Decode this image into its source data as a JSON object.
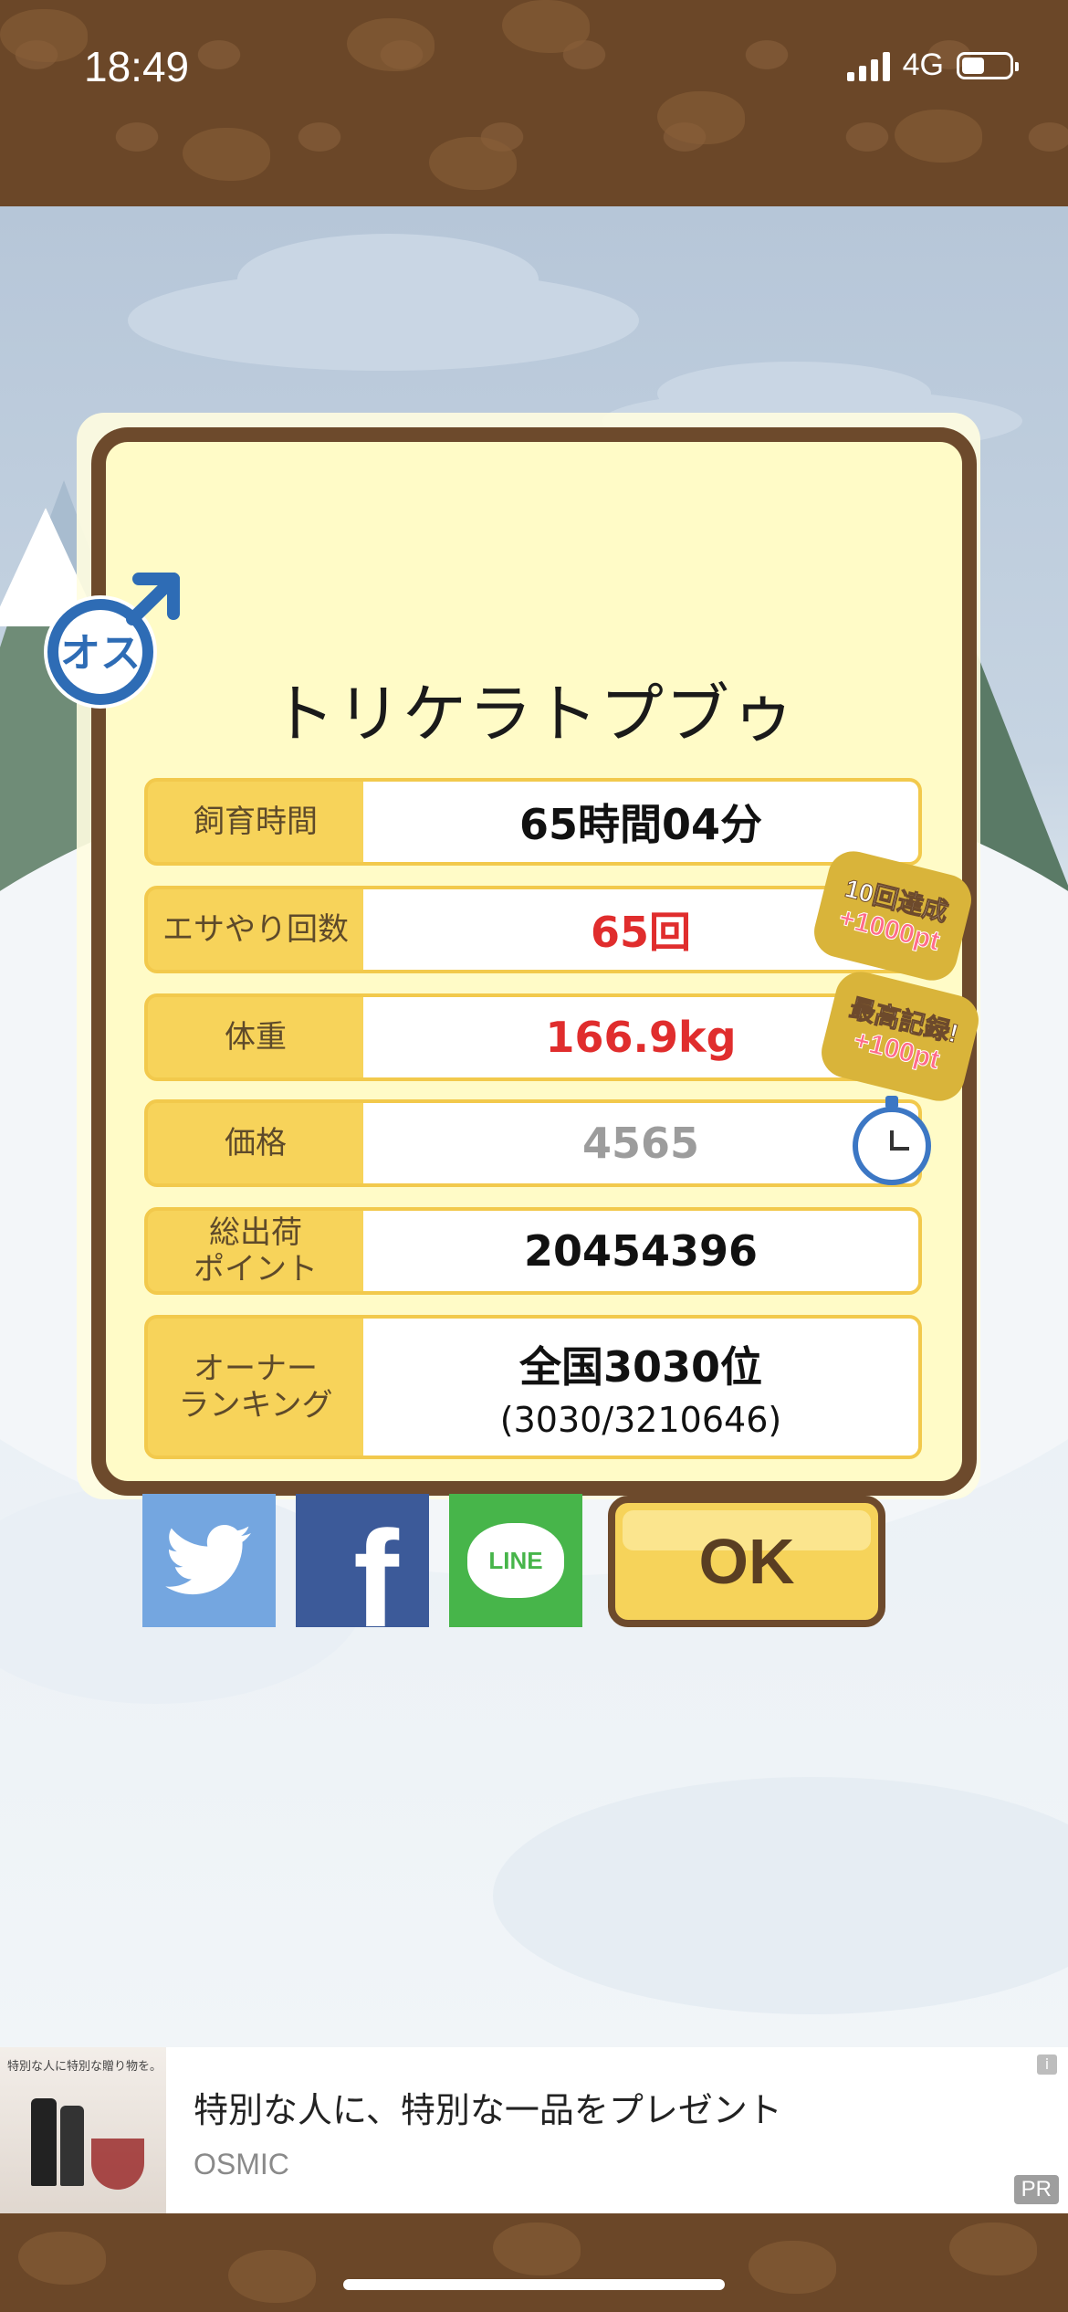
{
  "status_bar": {
    "time": "18:49",
    "network": "4G"
  },
  "pig": {
    "gender_label": "オス",
    "name": "トリケラトプブゥ",
    "stats": [
      {
        "label": "飼育時間",
        "value": "65時間04分",
        "style": "normal"
      },
      {
        "label": "エサやり回数",
        "value": "65回",
        "style": "red"
      },
      {
        "label": "体重",
        "value": "166.9kg",
        "style": "red"
      },
      {
        "label": "価格",
        "value": "4565",
        "style": "gray"
      },
      {
        "label": "総出荷\nポイント",
        "value": "20454396",
        "style": "normal"
      },
      {
        "label": "オーナー\nランキング",
        "value": "全国3030位",
        "sub": "(3030/3210646)",
        "style": "normal"
      }
    ]
  },
  "badges": {
    "first": {
      "line1": "10回達成",
      "line2": "+1000pt"
    },
    "second": {
      "line1": "最高記録!",
      "line2": "+100pt"
    }
  },
  "share": {
    "facebook_glyph": "f",
    "line_label": "LINE"
  },
  "ok_button": {
    "label": "OK"
  },
  "ad": {
    "title": "特別な人に、特別な一品をプレゼント",
    "source": "OSMIC",
    "image_caption": "特別な人に特別な贈り物を。",
    "info": "i",
    "pr": "PR"
  }
}
